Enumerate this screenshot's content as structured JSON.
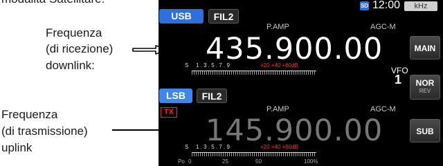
{
  "captions": {
    "top_partial": "modalità Satellitare:",
    "downlink_l1": "Frequenza",
    "downlink_l2": "(di ricezione)",
    "downlink_l3": "downlink:",
    "uplink_l1": "Frequenza",
    "uplink_l2": "(di trasmissione)",
    "uplink_l3": "uplink"
  },
  "status": {
    "sd_icon": "SD",
    "clock": "12:00",
    "unit": "kHz"
  },
  "main_band": {
    "mode": "USB",
    "filter": "FIL2",
    "preamp": "P.AMP",
    "agc": "AGC-M",
    "frequency": "435.900.00",
    "meter_s": "S",
    "meter_scale": "1 . 3 . 5 . 7 . 9",
    "meter_plus": "+20  +40  +60dB"
  },
  "sub_band": {
    "mode": "LSB",
    "filter": "FIL2",
    "tx": "TX",
    "preamp": "P.AMP",
    "agc": "AGC-M",
    "frequency": "145.900.00",
    "meter_s": "S",
    "meter_scale": "1 . 3 . 5 . 7 . 9",
    "meter_plus": "+20  +40  +60dB",
    "po_label": "Po",
    "po_scale": [
      "0",
      "25",
      "50",
      "100%"
    ]
  },
  "side_buttons": {
    "main": "MAIN",
    "vfo_label": "VFO",
    "vfo_value": "1",
    "nor": "NOR",
    "rev": "REV",
    "sub": "SUB"
  },
  "colors": {
    "accent_blue": "#2f6fdb",
    "tx_red": "#ff2020",
    "main_freq": "#ffffff",
    "sub_freq": "#777777"
  }
}
